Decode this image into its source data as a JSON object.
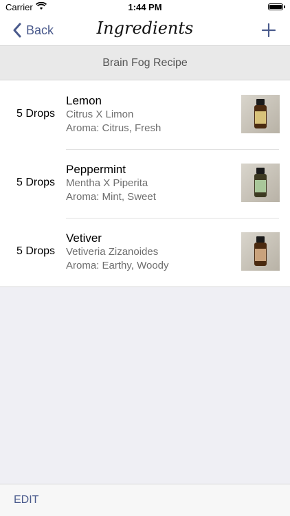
{
  "status_bar": {
    "carrier": "Carrier",
    "time": "1:44 PM"
  },
  "nav": {
    "back_label": "Back",
    "title": "Ingredients"
  },
  "section": {
    "title": "Brain Fog Recipe"
  },
  "ingredients": [
    {
      "drops": "5 Drops",
      "name": "Lemon",
      "latin": "Citrus X Limon",
      "aroma": "Aroma: Citrus, Fresh",
      "label_color": "#d8c27a"
    },
    {
      "drops": "5 Drops",
      "name": "Peppermint",
      "latin": "Mentha X Piperita",
      "aroma": "Aroma: Mint, Sweet",
      "label_color": "#a9c79a"
    },
    {
      "drops": "5 Drops",
      "name": "Vetiver",
      "latin": "Vetiveria Zizanoides",
      "aroma": "Aroma: Earthy, Woody",
      "label_color": "#c9a27c"
    }
  ],
  "toolbar": {
    "edit_label": "EDIT"
  },
  "colors": {
    "accent": "#4a5a8c",
    "background": "#efeff4"
  }
}
